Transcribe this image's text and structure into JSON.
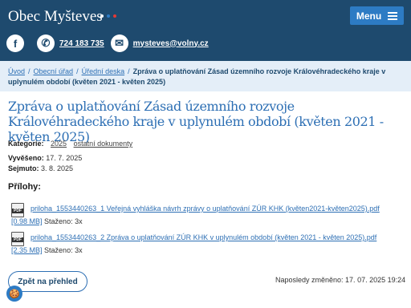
{
  "header": {
    "site_title": "Obec Myšteves",
    "dot_colors": [
      "#ffffff",
      "#2d7bc4",
      "#e53935"
    ],
    "menu_label": "Menu",
    "menu_icon": "hamburger-icon",
    "background": "#1e4a6e",
    "accent": "#2d7bc4"
  },
  "contacts": {
    "facebook_icon": "f",
    "phone_icon": "✆",
    "phone": "724 183 735",
    "email_icon": "✉",
    "email": "mysteves@volny.cz"
  },
  "breadcrumb": {
    "items": [
      "Úvod",
      "Obecní úřad",
      "Úřední deska"
    ],
    "separator": "/",
    "current": "Zpráva o uplatňování Zásad územního rozvoje Královéhradeckého kraje v uplynulém období (květen 2021 - květen 2025)"
  },
  "page_title": "Zpráva o uplatňování Zásad územního rozvoje Královéhradeckého kraje v uplynulém období (květen 2021 - květen 2025)",
  "meta": {
    "categories_label": "Kategorie:",
    "categories": [
      "2025",
      "ostatní dokumenty"
    ],
    "posted_label": "Vyvěšeno:",
    "posted": "17. 7. 2025",
    "removed_label": "Sejmuto:",
    "removed": "3. 8. 2025"
  },
  "attachments": {
    "heading": "Přílohy:",
    "items": [
      {
        "icon": "pdf-icon",
        "icon_text": "PDF",
        "name": "priloha_1553440263_1 Veřejná vyhláška návrh zprávy o uplatňování ZÚR KHK (květen2021-květen2025).pdf",
        "size": "[0.98 MB]",
        "downloads": "Staženo: 3x"
      },
      {
        "icon": "pdf-icon",
        "icon_text": "PDF",
        "name": "priloha_1553440263_2 Zpráva o uplatňování ZÚR KHK v uplynulém období (květen 2021 - květen 2025).pdf",
        "size": "[2.35 MB]",
        "downloads": "Staženo: 3x"
      }
    ]
  },
  "footer": {
    "back_label": "Zpět na přehled",
    "last_changed": "Naposledy změněno: 17. 07. 2025 19:24",
    "cookie_icon": "cookie-icon",
    "cookie_glyph": "🍪"
  }
}
